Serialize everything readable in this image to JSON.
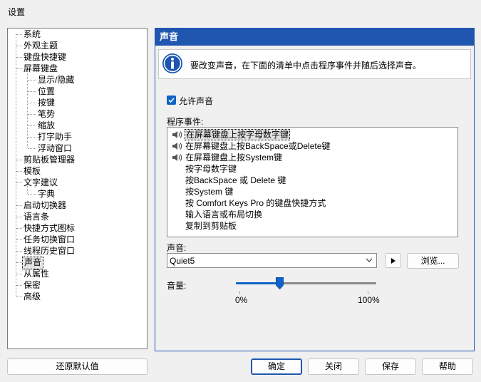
{
  "window": {
    "title": "设置"
  },
  "tree": {
    "items": [
      {
        "label": "系统"
      },
      {
        "label": "外观主题"
      },
      {
        "label": "键盘快捷键"
      },
      {
        "label": "屏幕键盘"
      },
      {
        "label": "显示/隐藏"
      },
      {
        "label": "位置"
      },
      {
        "label": "按键"
      },
      {
        "label": "笔势"
      },
      {
        "label": "缩放"
      },
      {
        "label": "打字助手"
      },
      {
        "label": "浮动窗口"
      },
      {
        "label": "剪贴板管理器"
      },
      {
        "label": "模板"
      },
      {
        "label": "文字建议"
      },
      {
        "label": "字典"
      },
      {
        "label": "启动切换器"
      },
      {
        "label": "语言条"
      },
      {
        "label": "快捷方式图标"
      },
      {
        "label": "任务切换窗口"
      },
      {
        "label": "线程历史窗口"
      },
      {
        "label": "声音"
      },
      {
        "label": "从属性"
      },
      {
        "label": "保密"
      },
      {
        "label": "高级"
      }
    ]
  },
  "panel": {
    "header": "声音",
    "info_text": "要改变声音，在下面的清单中点击程序事件并随后选择声音。",
    "allow_sound_label": "允许声音",
    "allow_sound_checked": true,
    "events_label": "程序事件:",
    "events": [
      {
        "label": "在屏幕键盘上按字母数字键",
        "has_sound": true
      },
      {
        "label": "在屏幕键盘上按BackSpace或Delete键",
        "has_sound": true
      },
      {
        "label": "在屏幕键盘上按System键",
        "has_sound": true
      },
      {
        "label": "按字母数字键",
        "has_sound": false
      },
      {
        "label": "按BackSpace 或 Delete 键",
        "has_sound": false
      },
      {
        "label": "按System 键",
        "has_sound": false
      },
      {
        "label": "按 Comfort Keys Pro 的键盘快捷方式",
        "has_sound": false
      },
      {
        "label": "输入语言或布局切换",
        "has_sound": false
      },
      {
        "label": "复制到剪贴板",
        "has_sound": false
      }
    ],
    "sound_label": "声音:",
    "sound_value": "Quiet5",
    "browse_label": "浏览...",
    "volume_label": "音量:",
    "volume_min_label": "0%",
    "volume_max_label": "100%",
    "volume_fraction": 0.31
  },
  "footer": {
    "reset_label": "还原默认值",
    "ok_label": "确定",
    "close_label": "关闭",
    "save_label": "保存",
    "help_label": "帮助"
  },
  "colors": {
    "accent": "#1e56b0",
    "checkbox": "#0f62c8"
  }
}
